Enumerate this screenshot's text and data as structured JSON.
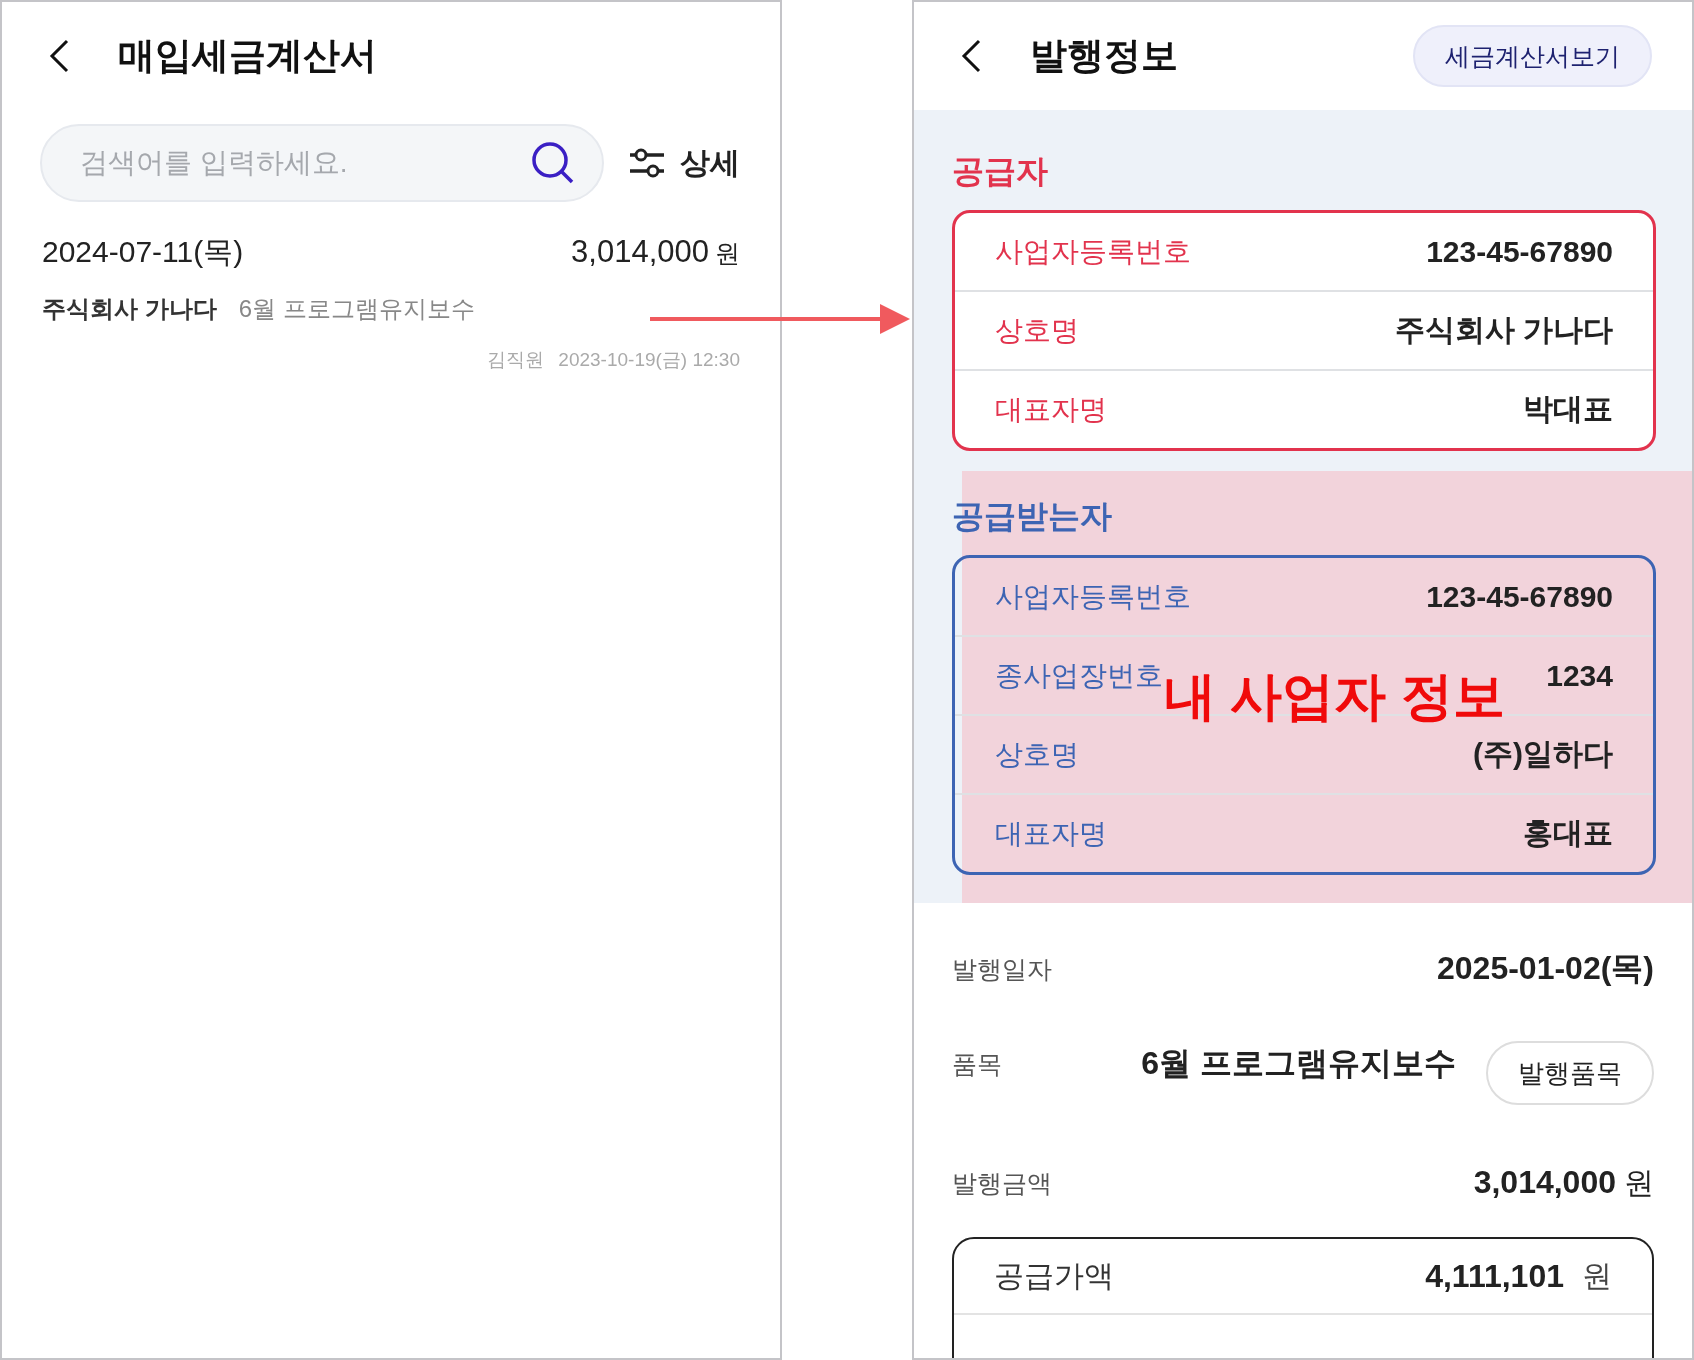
{
  "left_screen": {
    "title": "매입세금계산서",
    "search": {
      "placeholder": "검색어를 입력하세요."
    },
    "filter_button": "상세",
    "invoices": [
      {
        "date": "2024-07-11(목)",
        "amount": "3,014,000",
        "unit": "원",
        "company": "주식회사 가나다",
        "item": "6월 프로그램유지보수",
        "author": "김직원",
        "timestamp": "2023-10-19(금) 12:30"
      }
    ]
  },
  "right_screen": {
    "title": "발행정보",
    "view_button": "세금계산서보기",
    "parties": [
      {
        "kind": "supplier",
        "title": "공급자",
        "fields": [
          {
            "label": "사업자등록번호",
            "value": "123-45-67890"
          },
          {
            "label": "상호명",
            "value": "주식회사 가나다"
          },
          {
            "label": "대표자명",
            "value": "박대표"
          }
        ]
      },
      {
        "kind": "recipient",
        "title": "공급받는자",
        "highlighted": true,
        "fields": [
          {
            "label": "사업자등록번호",
            "value": "123-45-67890"
          },
          {
            "label": "종사업장번호",
            "value": "1234"
          },
          {
            "label": "상호명",
            "value": "(주)일하다"
          },
          {
            "label": "대표자명",
            "value": "홍대표"
          }
        ]
      }
    ],
    "details": [
      {
        "label": "발행일자",
        "value": "2025-01-02(목)"
      },
      {
        "label": "품목",
        "value": "6월 프로그램유지보수",
        "button": "발행품목"
      },
      {
        "label": "발행금액",
        "value": "3,014,000",
        "unit": "원"
      }
    ],
    "amounts": [
      {
        "label": "공급가액",
        "value": "4,111,101",
        "unit": "원"
      }
    ]
  },
  "annotation": {
    "text": "내 사업자 정보"
  }
}
